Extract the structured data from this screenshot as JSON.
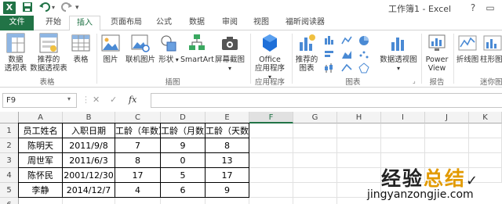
{
  "titlebar": {
    "app_logo": "X",
    "window_title": "工作簿1 - Excel",
    "icons": [
      "excel-logo-icon",
      "save-icon",
      "undo-icon",
      "redo-icon",
      "customize-icon"
    ]
  },
  "tabs": [
    "文件",
    "开始",
    "插入",
    "页面布局",
    "公式",
    "数据",
    "审阅",
    "视图",
    "福昕阅读器"
  ],
  "active_tab": "插入",
  "ribbon": {
    "tables": {
      "pivot": [
        "数据",
        "透视表"
      ],
      "recommended_pivot": [
        "推荐的",
        "数据透视表"
      ],
      "table": "表格",
      "group": "表格"
    },
    "illustrations": {
      "picture": "图片",
      "online_picture": "联机图片",
      "shapes": "形状",
      "smartart": "SmartArt",
      "screenshot": "屏幕截图",
      "group": "插图"
    },
    "apps": {
      "office": [
        "Office",
        "应用程序"
      ],
      "group": "应用程序"
    },
    "charts": {
      "recommended": [
        "推荐的",
        "图表"
      ],
      "pivot_chart": "数据透视图",
      "group": "图表"
    },
    "reports": {
      "power_view": [
        "Power",
        "View"
      ],
      "group": "报告"
    },
    "sparklines": {
      "line": "折线图",
      "column": "柱形图",
      "group": "迷你图"
    }
  },
  "formula_bar": {
    "cell_ref": "F9",
    "fx": "fx",
    "value": ""
  },
  "sheet": {
    "columns": [
      "A",
      "B",
      "C",
      "D",
      "E",
      "F",
      "G",
      "H",
      "I",
      "J",
      "K"
    ],
    "selected_column": "F",
    "rows": [
      "1",
      "2",
      "3",
      "4",
      "5",
      "6"
    ],
    "headers": [
      "员工姓名",
      "入职日期",
      "工龄（年数）",
      "工龄（月数）",
      "工龄（天数）"
    ],
    "data": [
      [
        "陈明天",
        "2011/9/8",
        "7",
        "9",
        "8"
      ],
      [
        "周世军",
        "2011/6/3",
        "8",
        "0",
        "13"
      ],
      [
        "陈怀民",
        "2001/12/30",
        "17",
        "5",
        "17"
      ],
      [
        "李静",
        "2014/12/7",
        "4",
        "6",
        "9"
      ]
    ]
  },
  "watermark": {
    "text_a": "经验",
    "text_b": "总结",
    "url": "jingyanzongjie.com"
  },
  "colors": {
    "excel_green": "#217346",
    "watermark_accent": "#e29a00"
  }
}
